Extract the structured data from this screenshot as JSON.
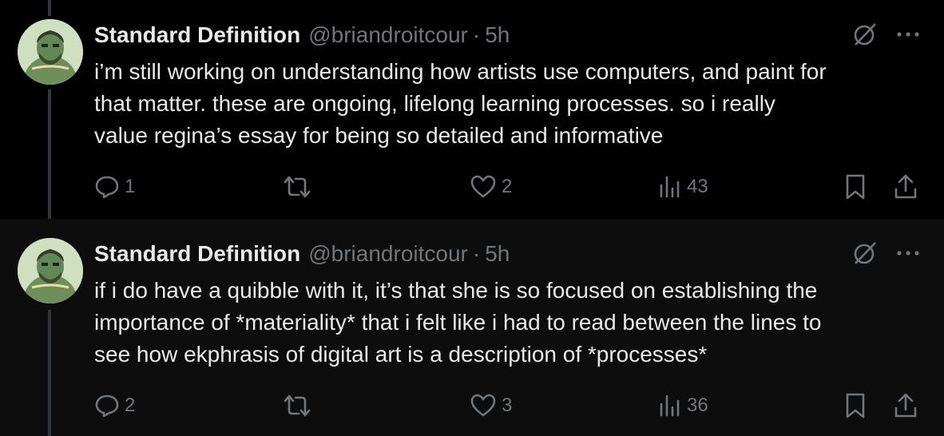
{
  "colors": {
    "background": "#000000",
    "second_background": "#0d0d0d",
    "text": "#e7e9ea",
    "muted": "#71767b",
    "thread_line": "#333639"
  },
  "tweets": [
    {
      "author_name": "Standard Definition",
      "handle": "@briandroitcour",
      "separator": "·",
      "time": "5h",
      "text": "i’m still working on understanding how artists use computers, and paint for\nthat matter. these are ongoing, lifelong learning processes. so i really\nvalue regina’s essay for being so detailed and informative",
      "replies": "1",
      "reposts": "",
      "likes": "2",
      "views": "43",
      "icons": [
        "grok-icon",
        "more-icon",
        "reply-icon",
        "retweet-icon",
        "heart-icon",
        "views-icon",
        "bookmark-icon",
        "share-icon"
      ]
    },
    {
      "author_name": "Standard Definition",
      "handle": "@briandroitcour",
      "separator": "·",
      "time": "5h",
      "text": "if i do have a quibble with it, it’s that she is so focused on establishing the\nimportance of *materiality* that i felt like i had to read between the lines to\nsee how ekphrasis of digital art is a description of *processes*",
      "replies": "2",
      "reposts": "",
      "likes": "3",
      "views": "36",
      "icons": [
        "grok-icon",
        "more-icon",
        "reply-icon",
        "retweet-icon",
        "heart-icon",
        "views-icon",
        "bookmark-icon",
        "share-icon"
      ]
    }
  ]
}
